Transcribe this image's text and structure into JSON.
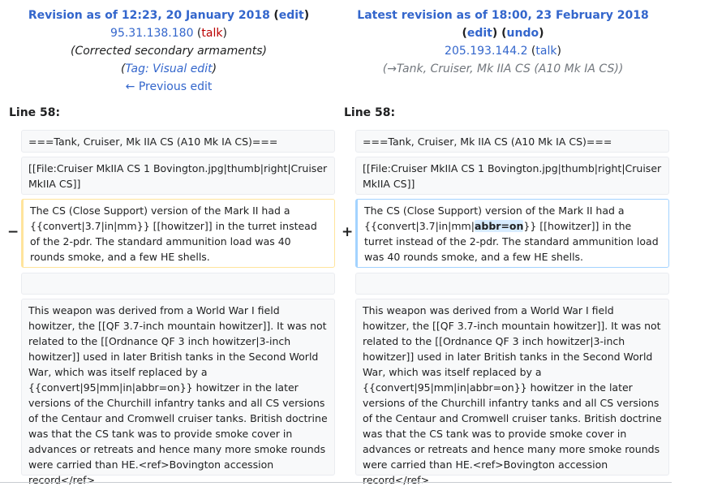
{
  "left": {
    "title": "Revision as of 12:23, 20 January 2018",
    "edit": "edit",
    "ip": "95.31.138.180",
    "talk": "talk",
    "summary": "(Corrected secondary armaments)",
    "tag": "Tag: Visual edit",
    "prev": "← Previous edit"
  },
  "right": {
    "title": "Latest revision as of 18:00, 23 February 2018",
    "edit": "edit",
    "undo": "undo",
    "ip": "205.193.144.2",
    "talk": "talk",
    "arrow": "→",
    "summary": "Tank, Cruiser, Mk IIA CS (A10 Mk IA CS)"
  },
  "line_label": "Line 58:",
  "rows": {
    "heading": "===Tank, Cruiser, Mk IIA CS (A10 Mk IA CS)===",
    "file": "[[File:Cruiser MkIIA CS 1 Bovington.jpg|thumb|right|Cruiser MkIIA CS]]",
    "changed_left": "The CS (Close Support) version of the Mark II had a {{convert|3.7|in|mm}} [[howitzer]] in the turret instead of the 2-pdr. The standard ammunition load was 40 rounds smoke, and a few HE shells.",
    "changed_right_pre": "The CS (Close Support) version of the Mark II had a {{convert|3.7|in|mm|",
    "changed_right_ins": "abbr=on",
    "changed_right_post": "}} [[howitzer]] in the turret instead of the 2-pdr. The standard ammunition load was 40 rounds smoke, and a few HE shells.",
    "paragraph": "This weapon was derived from a World War I field howitzer, the [[QF 3.7-inch mountain howitzer]]. It was not related to the [[Ordnance QF 3 inch howitzer|3-inch howitzer]] used in later British tanks in the Second World War, which was itself replaced by a {{convert|95|mm|in|abbr=on}} howitzer in the later versions of the Churchill infantry tanks and all CS versions of the Centaur and Cromwell cruiser tanks. British doctrine was that the CS tank was to provide smoke cover in advances or retreats and hence many more smoke rounds were carried than HE.<ref>Bovington accession record</ref>"
  },
  "markers": {
    "minus": "−",
    "plus": "+"
  },
  "colors": {
    "link": "#3366cc",
    "deleted_border": "#ffe49c",
    "added_border": "#a3d3ff",
    "inserted_bg": "#d8ecff"
  }
}
